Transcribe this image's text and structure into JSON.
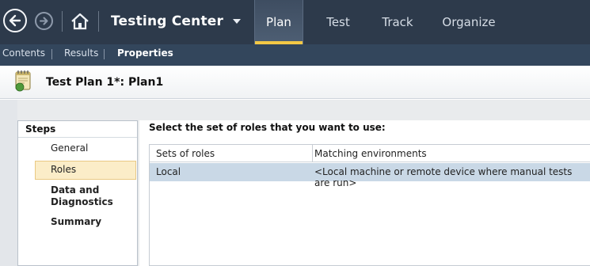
{
  "header": {
    "app_title": "Testing Center",
    "tabs": [
      {
        "label": "Plan"
      },
      {
        "label": "Test"
      },
      {
        "label": "Track"
      },
      {
        "label": "Organize"
      }
    ],
    "accent_color": "#f3c845"
  },
  "subnav": {
    "contents": "Contents",
    "results": "Results",
    "properties": "Properties"
  },
  "page": {
    "title": "Test Plan 1*: Plan1"
  },
  "steps": {
    "heading": "Steps",
    "items": [
      {
        "label": "General"
      },
      {
        "label": "Roles"
      },
      {
        "label": "Data and Diagnostics"
      },
      {
        "label": "Summary"
      }
    ]
  },
  "main": {
    "instruction": "Select the set of roles that you want to use:",
    "table": {
      "columns": [
        "Sets of roles",
        "Matching environments"
      ],
      "rows": [
        {
          "set": "Local",
          "env": "<Local machine or remote device where manual tests are run>"
        }
      ]
    }
  }
}
